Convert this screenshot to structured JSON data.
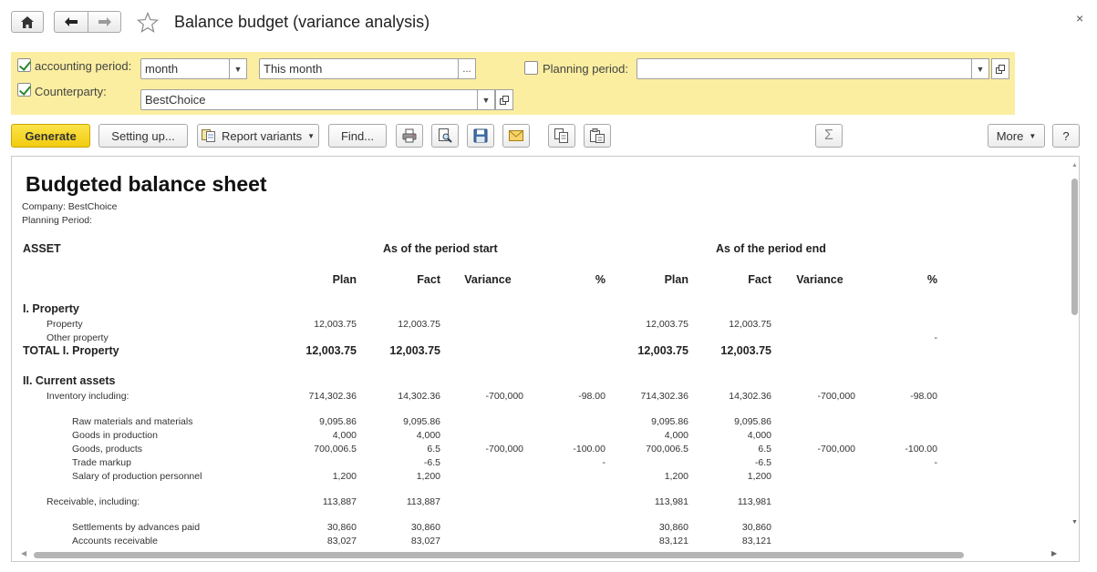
{
  "window": {
    "title": "Balance budget (variance analysis)",
    "close_glyph": "×"
  },
  "nav": {
    "home_icon": "home-icon",
    "back_icon": "arrow-left-icon",
    "forward_icon": "arrow-right-icon",
    "favorite_icon": "star-icon"
  },
  "filters": {
    "accounting_period": {
      "checked": true,
      "label": "accounting period:",
      "unit": "month",
      "value": "This month",
      "more": "..."
    },
    "planning_period": {
      "checked": false,
      "label": "Planning period:",
      "value": ""
    },
    "counterparty": {
      "checked": true,
      "label": "Counterparty:",
      "value": "BestChoice"
    }
  },
  "toolbar": {
    "generate": "Generate",
    "setting_up": "Setting up...",
    "report_variants": "Report variants",
    "find": "Find...",
    "more": "More",
    "help": "?",
    "sum": "Σ"
  },
  "report": {
    "title": "Budgeted balance sheet",
    "company": "Company: BestChoice",
    "planning_period": "Planning Period:",
    "section_label": "ASSET",
    "group_start": "As of the period start",
    "group_end": "As of the period end",
    "columns": [
      "Plan",
      "Fact",
      "Variance",
      "%",
      "Plan",
      "Fact",
      "Variance",
      "%"
    ],
    "rows": [
      {
        "label": "I. Property",
        "style": "section",
        "values": [
          "",
          "",
          "",
          "",
          "",
          "",
          "",
          ""
        ]
      },
      {
        "label": "Property",
        "style": "indent1",
        "values": [
          "12,003.75",
          "12,003.75",
          "",
          "",
          "12,003.75",
          "12,003.75",
          "",
          ""
        ]
      },
      {
        "label": "Other property",
        "style": "indent1",
        "values": [
          "",
          "",
          "",
          "",
          "",
          "",
          "",
          "-"
        ]
      },
      {
        "label": "TOTAL I. Property",
        "style": "total",
        "values": [
          "12,003.75",
          "12,003.75",
          "",
          "",
          "12,003.75",
          "12,003.75",
          "",
          ""
        ]
      },
      {
        "label": "II. Current assets",
        "style": "section",
        "values": [
          "",
          "",
          "",
          "",
          "",
          "",
          "",
          ""
        ]
      },
      {
        "label": "Inventory including:",
        "style": "indent1",
        "values": [
          "714,302.36",
          "14,302.36",
          "-700,000",
          "-98.00",
          "714,302.36",
          "14,302.36",
          "-700,000",
          "-98.00"
        ]
      },
      {
        "label": "Raw materials and materials",
        "style": "indent2",
        "values": [
          "9,095.86",
          "9,095.86",
          "",
          "",
          "9,095.86",
          "9,095.86",
          "",
          ""
        ]
      },
      {
        "label": "Goods in production",
        "style": "indent2",
        "values": [
          "4,000",
          "4,000",
          "",
          "",
          "4,000",
          "4,000",
          "",
          ""
        ]
      },
      {
        "label": "Goods, products",
        "style": "indent2",
        "values": [
          "700,006.5",
          "6.5",
          "-700,000",
          "-100.00",
          "700,006.5",
          "6.5",
          "-700,000",
          "-100.00"
        ]
      },
      {
        "label": "Trade markup",
        "style": "indent2",
        "values": [
          "",
          "-6.5",
          "",
          "-",
          "",
          "-6.5",
          "",
          "-"
        ]
      },
      {
        "label": "Salary of production personnel",
        "style": "indent2",
        "values": [
          "1,200",
          "1,200",
          "",
          "",
          "1,200",
          "1,200",
          "",
          ""
        ]
      },
      {
        "label": "Receivable, including:",
        "style": "indent1",
        "values": [
          "113,887",
          "113,887",
          "",
          "",
          "113,981",
          "113,981",
          "",
          ""
        ]
      },
      {
        "label": "Settlements by advances paid",
        "style": "indent2",
        "values": [
          "30,860",
          "30,860",
          "",
          "",
          "30,860",
          "30,860",
          "",
          ""
        ]
      },
      {
        "label": "Accounts receivable",
        "style": "indent2",
        "values": [
          "83,027",
          "83,027",
          "",
          "",
          "83,121",
          "83,121",
          "",
          ""
        ]
      }
    ]
  }
}
